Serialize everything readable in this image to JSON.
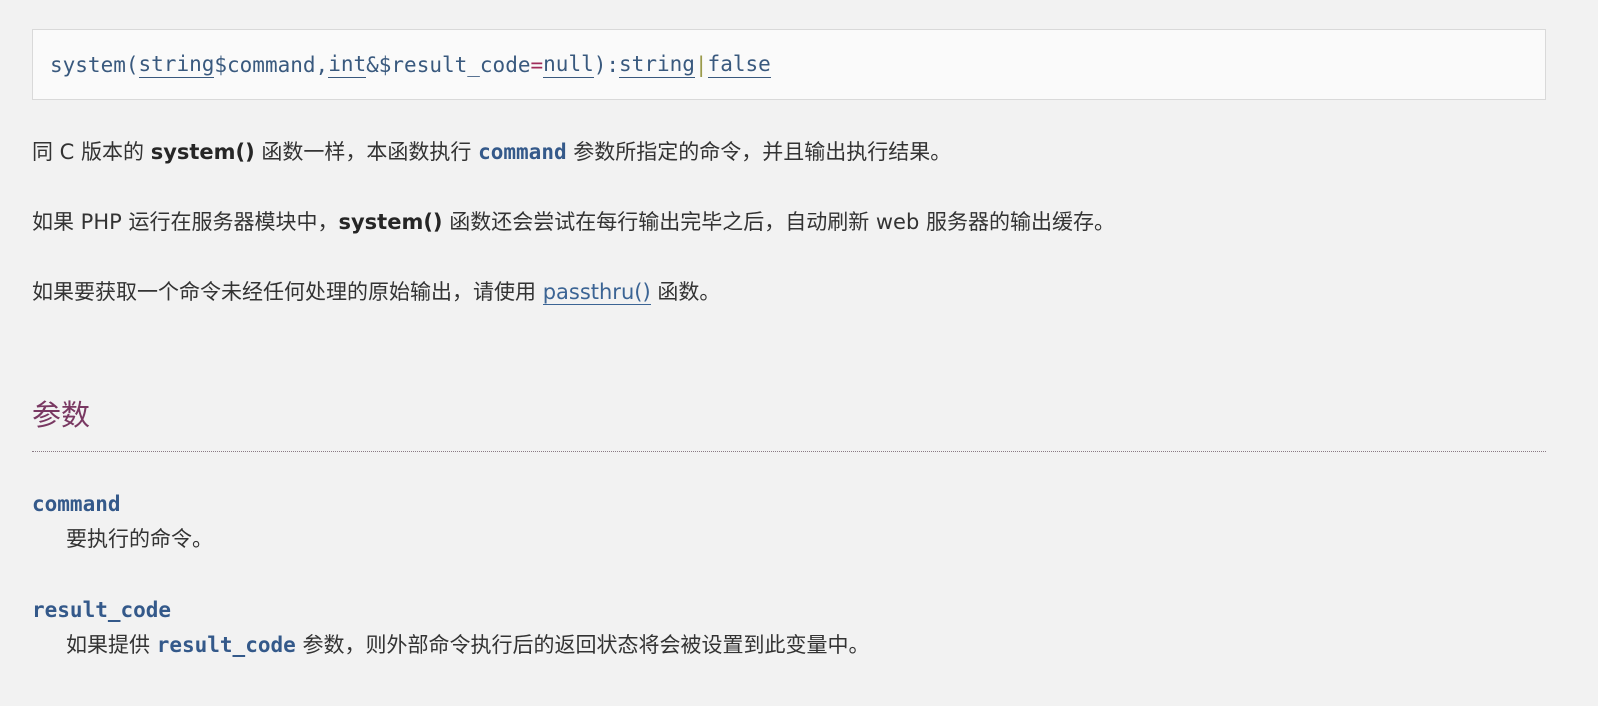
{
  "synopsis": {
    "func_name": "system",
    "open_paren": "(",
    "param1_type": "string",
    "param1_name": " $command",
    "comma": ", ",
    "param2_type": "int",
    "param2_name": " &$result_code ",
    "equals": "=",
    "space": " ",
    "param2_default": "null",
    "close_paren": "): ",
    "return_type1": "string",
    "pipe": "|",
    "return_type2": "false"
  },
  "description": {
    "p1_part1": "同 C 版本的 ",
    "p1_bold": "system()",
    "p1_part2": " 函数一样，本函数执行 ",
    "p1_code": "command",
    "p1_part3": " 参数所指定的命令，并且输出执行结果。",
    "p2_part1": "如果 PHP 运行在服务器模块中，",
    "p2_bold": "system()",
    "p2_part2": " 函数还会尝试在每行输出完毕之后，自动刷新 web 服务器的输出缓存。",
    "p3_part1": "如果要获取一个命令未经任何处理的原始输出，请使用 ",
    "p3_link": "passthru()",
    "p3_part2": " 函数。"
  },
  "parameters": {
    "title": "参数",
    "items": [
      {
        "name": "command",
        "desc": "要执行的命令。"
      },
      {
        "name": "result_code",
        "desc_part1": "如果提供 ",
        "desc_code": "result_code",
        "desc_part2": " 参数，则外部命令执行后的返回状态将会被设置到此变量中。"
      }
    ]
  },
  "colors": {
    "background": "#f2f2f2",
    "synopsis_bg": "#fafafa",
    "link": "#3b6494",
    "code": "#34598a",
    "heading": "#793862"
  }
}
